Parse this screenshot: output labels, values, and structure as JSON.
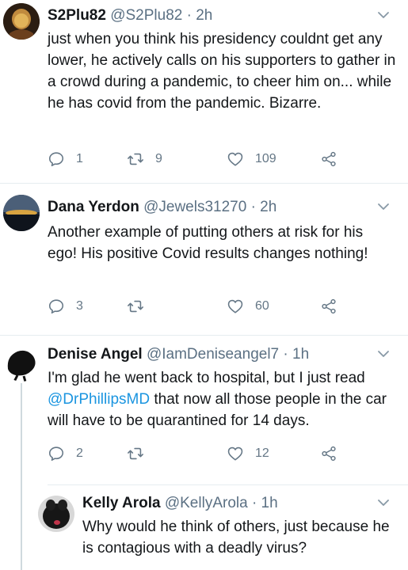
{
  "tweets": [
    {
      "name": "S2Plu82",
      "handle": "@S2Plu82",
      "time": "· 2h",
      "text": "just when you think his presidency couldnt get any lower, he actively calls on his supporters to gather in a crowd during a pandemic, to cheer him on... while he has covid from the pandemic. Bizarre.",
      "replies": "1",
      "retweets": "9",
      "likes": "109"
    },
    {
      "name": "Dana Yerdon",
      "handle": "@Jewels31270",
      "time": "· 2h",
      "text": "Another example of putting others at risk for his ego! His positive Covid results changes nothing!",
      "replies": "3",
      "retweets": "",
      "likes": "60"
    },
    {
      "name": "Denise Angel",
      "handle": "@IamDeniseangel7",
      "time": "· 1h",
      "text_before": "I'm glad he went back to hospital, but I just read ",
      "mention": "@DrPhillipsMD",
      "text_after": " that now all those people in the car will have to be quarantined for 14 days.",
      "replies": "2",
      "retweets": "",
      "likes": "12"
    },
    {
      "name": "Kelly Arola",
      "handle": "@KellyArola",
      "time": "· 1h",
      "text": "Why would he think of others, just because he is contagious with a deadly virus?"
    }
  ],
  "colors": {
    "secondary_text": "#5b7083",
    "link": "#1b95e0",
    "divider": "#e6ecf0"
  },
  "icons": [
    "reply-icon",
    "retweet-icon",
    "like-icon",
    "share-icon",
    "chevron-down-icon"
  ]
}
